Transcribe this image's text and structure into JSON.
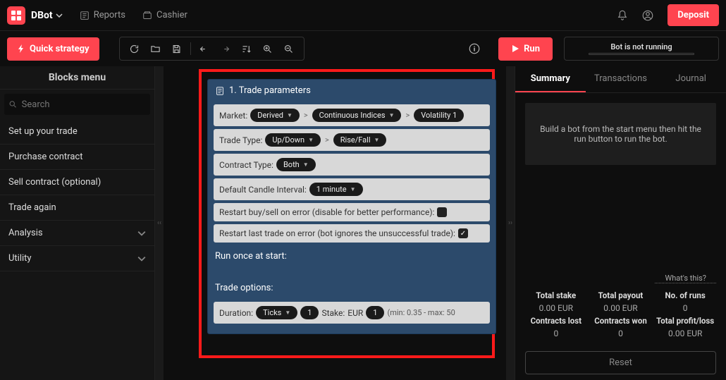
{
  "topbar": {
    "app_name": "DBot",
    "links": {
      "reports": "Reports",
      "cashier": "Cashier"
    },
    "deposit_btn": "Deposit"
  },
  "toolbar": {
    "quick_strategy": "Quick strategy",
    "run_btn": "Run",
    "run_status": "Bot is not running"
  },
  "sidebar": {
    "title": "Blocks menu",
    "search_placeholder": "Search",
    "items": [
      {
        "label": "Set up your trade",
        "expandable": false
      },
      {
        "label": "Purchase contract",
        "expandable": false
      },
      {
        "label": "Sell contract (optional)",
        "expandable": false
      },
      {
        "label": "Trade again",
        "expandable": false
      },
      {
        "label": "Analysis",
        "expandable": true
      },
      {
        "label": "Utility",
        "expandable": true
      }
    ]
  },
  "block": {
    "title": "1. Trade parameters",
    "market": {
      "label": "Market:",
      "level1": "Derived",
      "level2": "Continuous Indices",
      "level3": "Volatility 1"
    },
    "trade_type": {
      "label": "Trade Type:",
      "group": "Up/Down",
      "sub": "Rise/Fall"
    },
    "contract_type": {
      "label": "Contract Type:",
      "value": "Both"
    },
    "candle": {
      "label": "Default Candle Interval:",
      "value": "1 minute"
    },
    "restart_buysell": {
      "label": "Restart buy/sell on error (disable for better performance):",
      "checked": false
    },
    "restart_last": {
      "label": "Restart last trade on error (bot ignores the unsuccessful trade):",
      "checked": true
    },
    "run_once_label": "Run once at start:",
    "trade_options_label": "Trade options:",
    "duration": {
      "label": "Duration:",
      "unit": "Ticks",
      "value": "1",
      "stake_label": "Stake:",
      "currency": "EUR",
      "stake_value": "1",
      "minmax": "(min: 0.35 - max: 50"
    }
  },
  "right_panel": {
    "tabs": {
      "summary": "Summary",
      "transactions": "Transactions",
      "journal": "Journal"
    },
    "build_msg": "Build a bot from the start menu then hit the run button to run the bot.",
    "whats_this": "What's this?",
    "stats": {
      "total_stake": {
        "title": "Total stake",
        "value": "0.00 EUR"
      },
      "total_payout": {
        "title": "Total payout",
        "value": "0.00 EUR"
      },
      "no_of_runs": {
        "title": "No. of runs",
        "value": "0"
      },
      "contracts_lost": {
        "title": "Contracts lost",
        "value": "0"
      },
      "contracts_won": {
        "title": "Contracts won",
        "value": "0"
      },
      "total_pl": {
        "title": "Total profit/loss",
        "value": "0.00 EUR"
      }
    },
    "reset": "Reset"
  }
}
